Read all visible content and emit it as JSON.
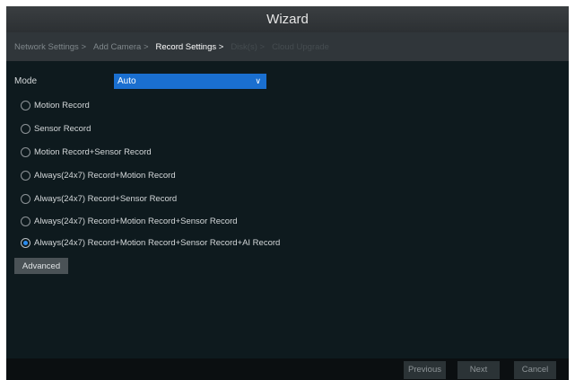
{
  "window": {
    "title": "Wizard"
  },
  "steps": [
    {
      "label": "Network Settings >",
      "state": "done"
    },
    {
      "label": "Add Camera >",
      "state": "done"
    },
    {
      "label": "Record Settings >",
      "state": "current"
    },
    {
      "label": "Disk(s) >",
      "state": "future"
    },
    {
      "label": "Cloud Upgrade",
      "state": "future"
    }
  ],
  "mode": {
    "label": "Mode",
    "value": "Auto"
  },
  "record_options": [
    {
      "label": "Motion Record",
      "checked": false
    },
    {
      "label": "Sensor Record",
      "checked": false
    },
    {
      "label": "Motion Record+Sensor Record",
      "checked": false
    },
    {
      "label": "Always(24x7) Record+Motion Record",
      "checked": false
    },
    {
      "label": "Always(24x7) Record+Sensor Record",
      "checked": false
    },
    {
      "label": "Always(24x7) Record+Motion Record+Sensor Record",
      "checked": false
    },
    {
      "label": "Always(24x7) Record+Motion Record+Sensor Record+AI Record",
      "checked": true
    }
  ],
  "advanced_label": "Advanced",
  "footer": {
    "previous": "Previous",
    "next": "Next",
    "cancel": "Cancel"
  },
  "colors": {
    "accent": "#1a6fd0",
    "background": "#0e1a1e",
    "radio_selected": "#2a8cf0"
  }
}
